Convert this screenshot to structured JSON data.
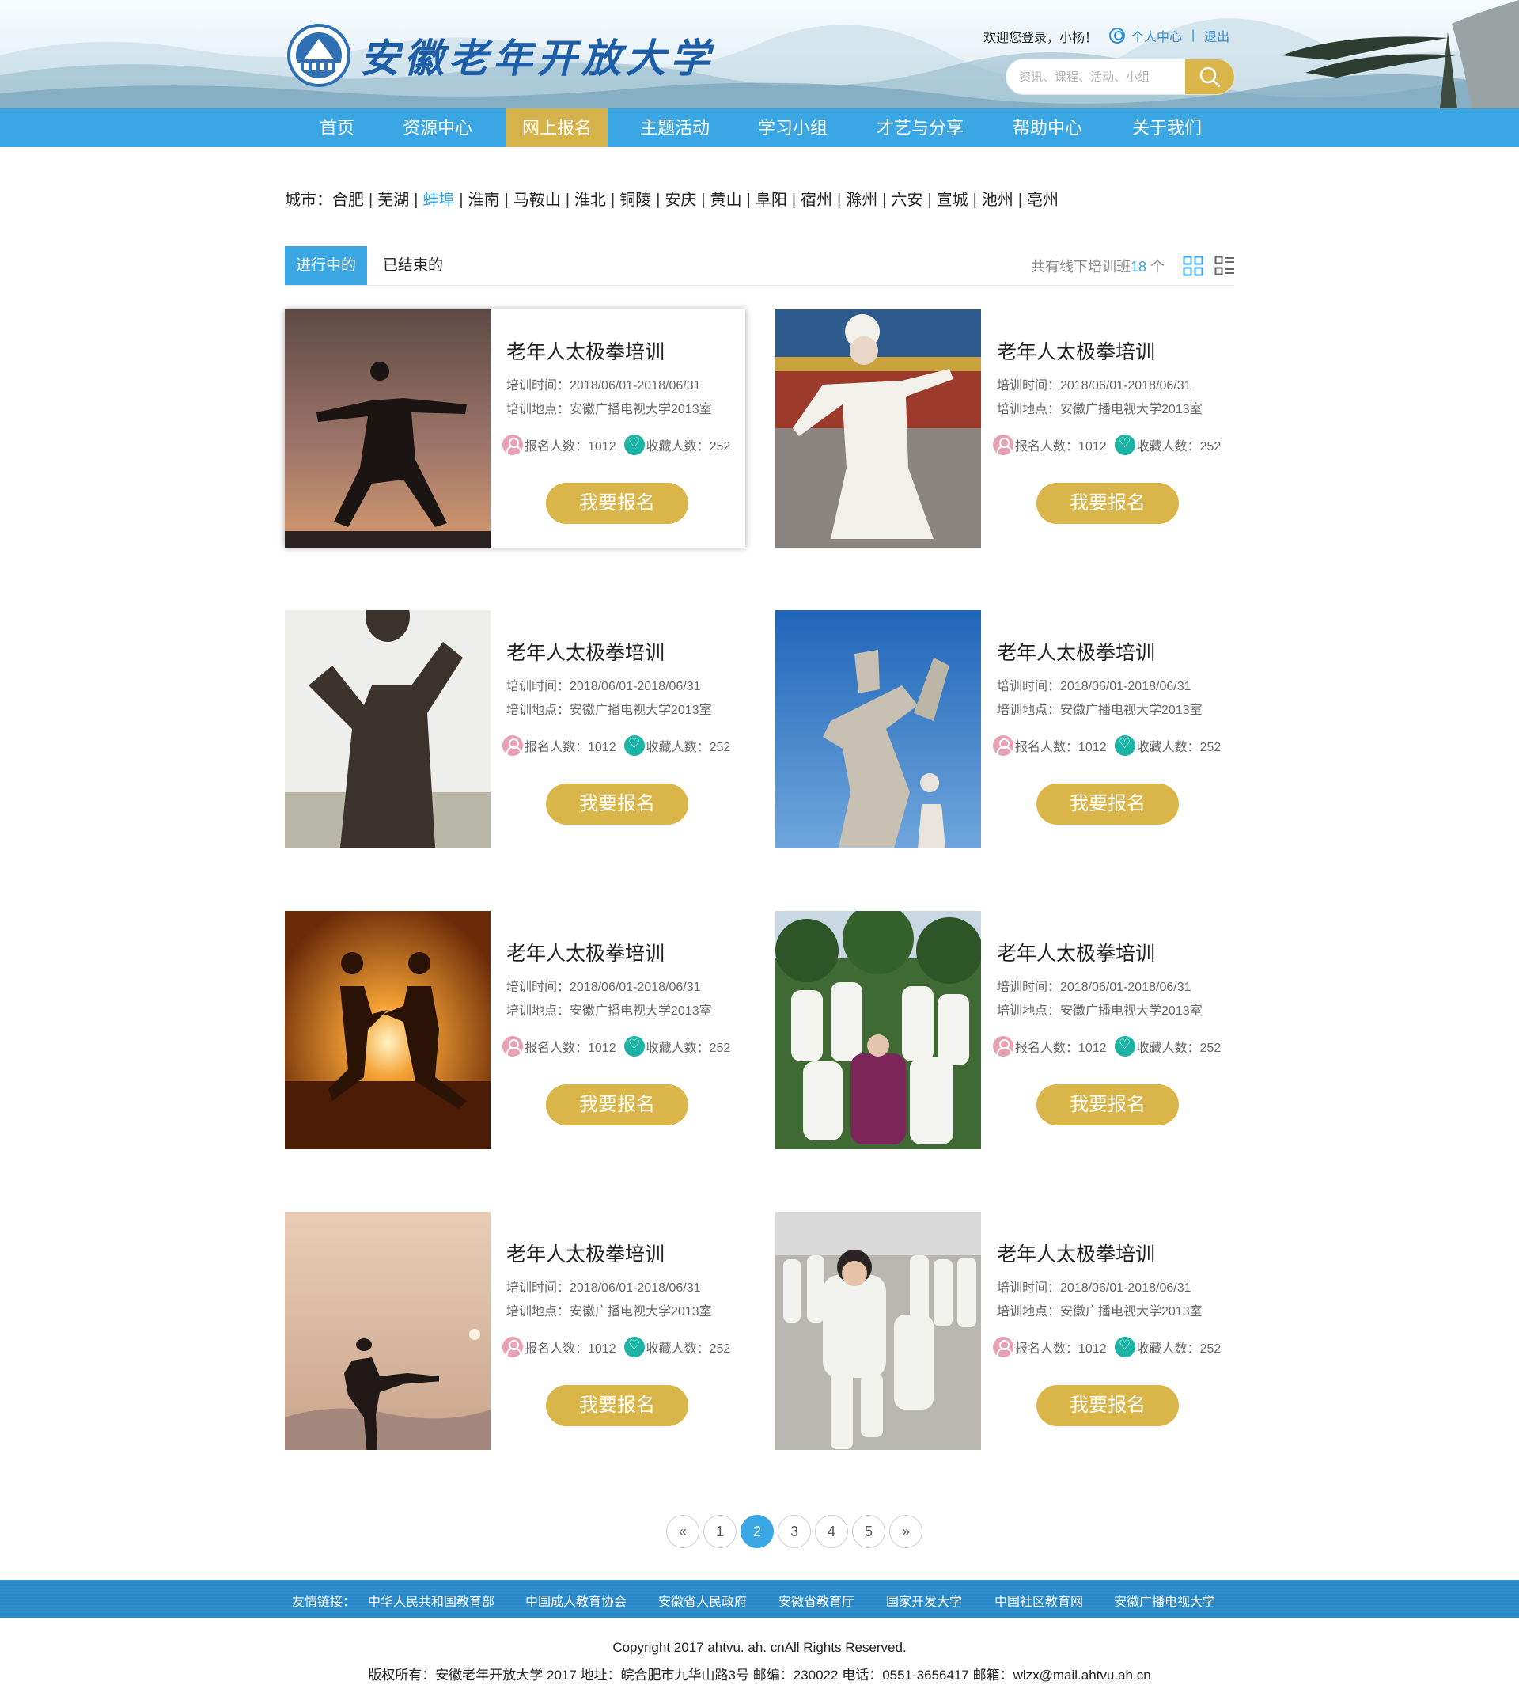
{
  "header": {
    "site_title": "安徽老年开放大学",
    "welcome": "欢迎您登录，小杨！",
    "personal_center": "个人中心",
    "separator": "|",
    "logout": "退出",
    "search_placeholder": "资讯、课程、活动、小组"
  },
  "nav": [
    "首页",
    "资源中心",
    "网上报名",
    "主题活动",
    "学习小组",
    "才艺与分享",
    "帮助中心",
    "关于我们"
  ],
  "nav_active": "网上报名",
  "cities": {
    "label": "城市：",
    "items": [
      "合肥",
      "芜湖",
      "蚌埠",
      "淮南",
      "马鞍山",
      "淮北",
      "铜陵",
      "安庆",
      "黄山",
      "阜阳",
      "宿州",
      "滁州",
      "六安",
      "宣城",
      "池州",
      "亳州"
    ],
    "active": "蚌埠"
  },
  "tabs": {
    "ongoing": "进行中的",
    "ended": "已结束的",
    "count_prefix": "共有线下培训班",
    "count": "18",
    "count_suffix": " 个"
  },
  "courses": [
    {
      "title": "老年人太极拳培训",
      "time": "培训时间：2018/06/01-2018/06/31",
      "place": "培训地点：安徽广播电视大学2013室",
      "enroll": "报名人数：1012",
      "fav": "收藏人数：252",
      "button": "我要报名"
    },
    {
      "title": "老年人太极拳培训",
      "time": "培训时间：2018/06/01-2018/06/31",
      "place": "培训地点：安徽广播电视大学2013室",
      "enroll": "报名人数：1012",
      "fav": "收藏人数：252",
      "button": "我要报名"
    },
    {
      "title": "老年人太极拳培训",
      "time": "培训时间：2018/06/01-2018/06/31",
      "place": "培训地点：安徽广播电视大学2013室",
      "enroll": "报名人数：1012",
      "fav": "收藏人数：252",
      "button": "我要报名"
    },
    {
      "title": "老年人太极拳培训",
      "time": "培训时间：2018/06/01-2018/06/31",
      "place": "培训地点：安徽广播电视大学2013室",
      "enroll": "报名人数：1012",
      "fav": "收藏人数：252",
      "button": "我要报名"
    },
    {
      "title": "老年人太极拳培训",
      "time": "培训时间：2018/06/01-2018/06/31",
      "place": "培训地点：安徽广播电视大学2013室",
      "enroll": "报名人数：1012",
      "fav": "收藏人数：252",
      "button": "我要报名"
    },
    {
      "title": "老年人太极拳培训",
      "time": "培训时间：2018/06/01-2018/06/31",
      "place": "培训地点：安徽广播电视大学2013室",
      "enroll": "报名人数：1012",
      "fav": "收藏人数：252",
      "button": "我要报名"
    },
    {
      "title": "老年人太极拳培训",
      "time": "培训时间：2018/06/01-2018/06/31",
      "place": "培训地点：安徽广播电视大学2013室",
      "enroll": "报名人数：1012",
      "fav": "收藏人数：252",
      "button": "我要报名"
    },
    {
      "title": "老年人太极拳培训",
      "time": "培训时间：2018/06/01-2018/06/31",
      "place": "培训地点：安徽广播电视大学2013室",
      "enroll": "报名人数：1012",
      "fav": "收藏人数：252",
      "button": "我要报名"
    }
  ],
  "pagination": {
    "prev": "«",
    "pages": [
      "1",
      "2",
      "3",
      "4",
      "5"
    ],
    "current": "2",
    "next": "»"
  },
  "footer": {
    "links_label": "友情链接：",
    "links": [
      "中华人民共和国教育部",
      "中国成人教育协会",
      "安徽省人民政府",
      "安徽省教育厅",
      "国家开发大学",
      "中国社区教育网",
      "安徽广播电视大学"
    ],
    "copyright": "Copyright 2017 ahtvu. ah. cnAll Rights Reserved.",
    "address": "版权所有：安徽老年开放大学 2017 地址：皖合肥市九华山路3号 邮编：230022 电话：0551-3656417 邮箱：wlzx@mail.ahtvu.ah.cn"
  },
  "colors": {
    "primary": "#3aa6e4",
    "accent": "#d9b54a",
    "title_blue": "#1e5ea8"
  },
  "icons": {
    "search": "search-icon",
    "user": "user-icon",
    "grid_view": "grid-view-icon",
    "list_view": "list-view-icon",
    "enroll": "people-icon",
    "favorite": "heart-icon"
  }
}
